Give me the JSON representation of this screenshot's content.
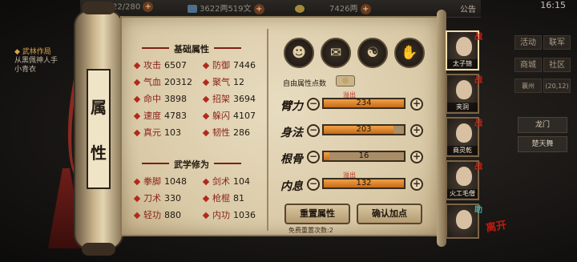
{
  "topbar": {
    "res1": "22/280",
    "res2": "3622两519文",
    "res3": "7426两",
    "announce": "公告",
    "time": "16:15"
  },
  "quest": {
    "title": "武林作局",
    "line1": "从黑佩神人手",
    "line2": "小青衣"
  },
  "title_tab": [
    "属",
    "性"
  ],
  "base": {
    "title": "基础属性",
    "left": [
      {
        "label": "攻击",
        "value": "6507"
      },
      {
        "label": "气血",
        "value": "20312"
      },
      {
        "label": "命中",
        "value": "3898"
      },
      {
        "label": "速度",
        "value": "4783"
      },
      {
        "label": "真元",
        "value": "103"
      }
    ],
    "right": [
      {
        "label": "防御",
        "value": "7446"
      },
      {
        "label": "聚气",
        "value": "12"
      },
      {
        "label": "招架",
        "value": "3694"
      },
      {
        "label": "躲闪",
        "value": "4107"
      },
      {
        "label": "韧性",
        "value": "286"
      }
    ]
  },
  "martial": {
    "title": "武学修为",
    "left": [
      {
        "label": "拳脚",
        "value": "1048"
      },
      {
        "label": "刀术",
        "value": "330"
      },
      {
        "label": "轻功",
        "value": "880"
      }
    ],
    "right": [
      {
        "label": "剑术",
        "value": "104"
      },
      {
        "label": "枪棍",
        "value": "81"
      },
      {
        "label": "内功",
        "value": "1036"
      }
    ]
  },
  "alloc": {
    "free_label": "自由属性点数",
    "free_value": "◎",
    "overflow_label": "溢出",
    "rows": [
      {
        "label": "臂力",
        "value": "234",
        "fill": 1.0,
        "overflow": true
      },
      {
        "label": "身法",
        "value": "203",
        "fill": 0.87,
        "overflow": false
      },
      {
        "label": "根骨",
        "value": "16",
        "fill": 0.07,
        "overflow": false
      },
      {
        "label": "内息",
        "value": "132",
        "fill": 1.0,
        "overflow": true
      }
    ],
    "minus": "−",
    "plus": "+"
  },
  "buttons": {
    "reset": "重置属性",
    "confirm": "确认加点",
    "free_reset": "免费重置次数:2"
  },
  "heroes": [
    {
      "name": "太子锦",
      "tag": "战"
    },
    {
      "name": "夹洞",
      "tag": "战"
    },
    {
      "name": "商灵乾",
      "tag": "战"
    },
    {
      "name": "火工毛僧",
      "tag": "战"
    },
    {
      "name": "",
      "tag": "助"
    }
  ],
  "stamp": "离开",
  "rmenu": {
    "items": [
      "活动",
      "联军",
      "商城",
      "社区"
    ],
    "row": [
      "襄州",
      "(20,12)"
    ],
    "btn1": "龙门",
    "btn2": "楚天舞"
  }
}
